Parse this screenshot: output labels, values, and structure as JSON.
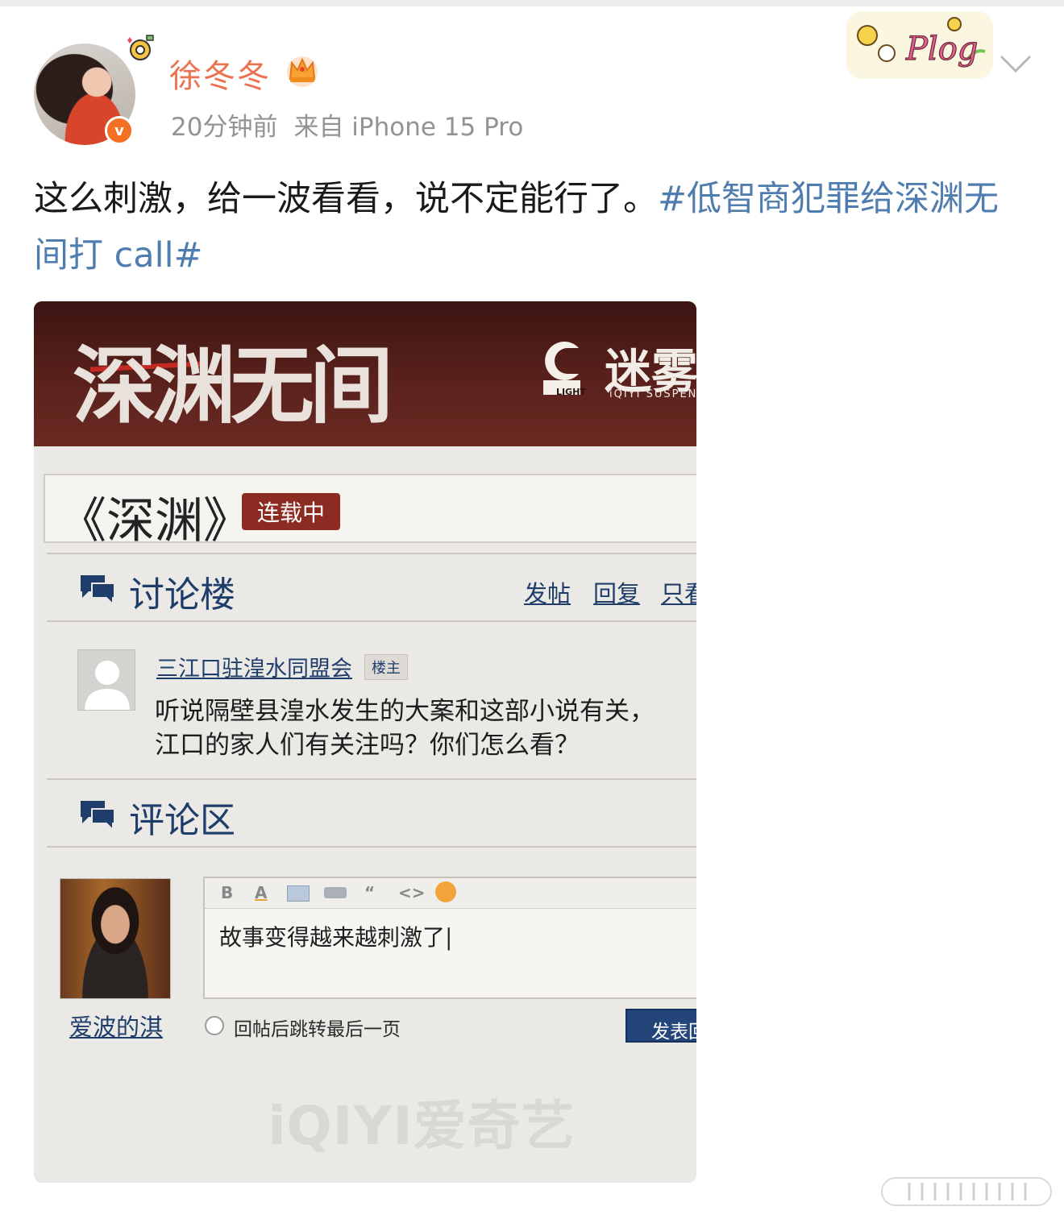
{
  "post": {
    "username": "徐冬冬",
    "time": "20分钟前",
    "source": "来自 iPhone 15 Pro",
    "text": "这么刺激，给一波看看，说不定能行了。",
    "topic": "#低智商犯罪给深渊无间打 call#",
    "badge_text": "Plog"
  },
  "poster": {
    "show_title": "深渊无间",
    "brand_cn": "迷雾",
    "brand_en": "iQIYI SUSPEN",
    "light_label": "LIGHT",
    "novel_title": "《深渊》",
    "serial_status": "连载中",
    "thread_section": "讨论楼",
    "actions": [
      "发帖",
      "回复",
      "只看"
    ],
    "op_name": "三江口驻湟水同盟会",
    "op_tag": "楼主",
    "op_line1": "听说隔壁县湟水发生的大案和这部小说有关，",
    "op_line2": "江口的家人们有关注吗？你们怎么看？",
    "comment_section": "评论区",
    "commenter_name": "爱波的淇",
    "editor_text": "故事变得越来越刺激了|",
    "checkbox_label": "回帖后跳转最后一页",
    "submit_label": "发表回",
    "watermark": "iQIYI爱奇艺"
  },
  "colors": {
    "username": "#eb7350",
    "topic_link": "#507daf",
    "verified": "#f36f21",
    "forum_blue": "#1f3d6a",
    "poster_header": "#5a211c"
  },
  "icons": [
    "crown-icon",
    "verified-icon",
    "chevron-down-icon",
    "chat-bubble-icon",
    "default-user-icon",
    "more-images-icon"
  ]
}
